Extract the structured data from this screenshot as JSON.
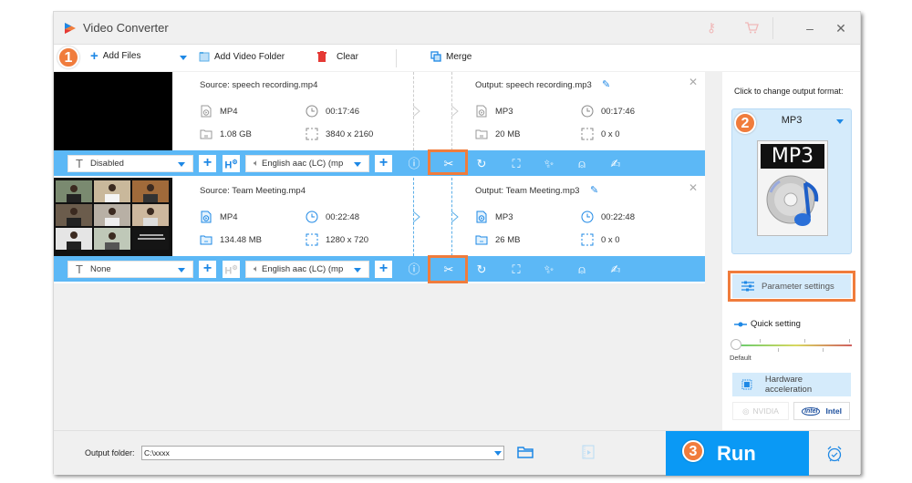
{
  "window": {
    "title": "Video Converter",
    "controls": {
      "minimize": "–",
      "close": "✕"
    }
  },
  "toolbar": {
    "step": "1",
    "add_files": "Add Files",
    "add_video_folder": "Add Video Folder",
    "clear": "Clear",
    "merge": "Merge"
  },
  "items": [
    {
      "source_label": "Source: speech recording.mp4",
      "source_format": "MP4",
      "source_duration": "00:17:46",
      "source_size": "1.08 GB",
      "source_resolution": "3840 x 2160",
      "output_label": "Output: speech recording.mp3",
      "output_format": "MP3",
      "output_duration": "00:17:46",
      "output_size": "20 MB",
      "output_resolution": "0 x 0",
      "subtitle": "Disabled",
      "audio": "English aac (LC) (mp",
      "thumbnail": "black-frame"
    },
    {
      "source_label": "Source: Team Meeting.mp4",
      "source_format": "MP4",
      "source_duration": "00:22:48",
      "source_size": "134.48 MB",
      "source_resolution": "1280 x 720",
      "output_label": "Output: Team Meeting.mp3",
      "output_format": "MP3",
      "output_duration": "00:22:48",
      "output_size": "26 MB",
      "output_resolution": "0 x 0",
      "subtitle": "None",
      "audio": "English aac (LC) (mp",
      "thumbnail": "video-call-grid"
    }
  ],
  "right_panel": {
    "label": "Click to change output format:",
    "step": "2",
    "format": "MP3",
    "format_icon_text": "MP3",
    "parameter_settings": "Parameter settings",
    "quick_setting": "Quick setting",
    "slider_label": "Default",
    "slider_value": 0,
    "hardware_acceleration": "Hardware acceleration",
    "nvidia": "NVIDIA",
    "intel": "Intel"
  },
  "footer": {
    "output_folder_label": "Output folder:",
    "output_folder_value": "C:\\xxxx",
    "step": "3",
    "run": "Run"
  },
  "colors": {
    "accent": "#0a99f5",
    "bar": "#5cb8f6",
    "highlight": "#f07c3c",
    "panel_blue": "#d5ebfb"
  }
}
